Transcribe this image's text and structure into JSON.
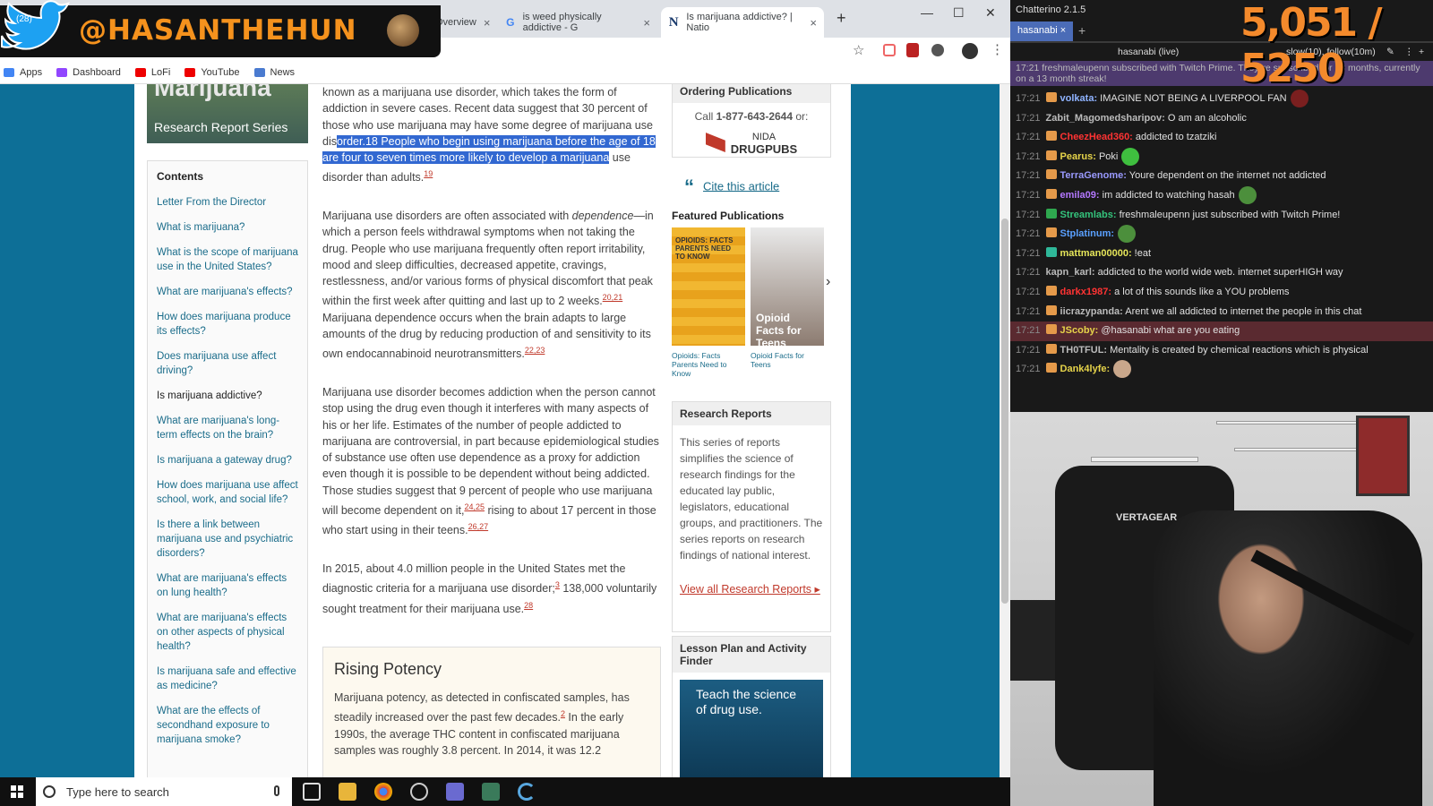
{
  "browser": {
    "tabs": [
      {
        "label": "Overview",
        "close": "×"
      },
      {
        "label": "is weed physically addictive - G",
        "close": "×"
      },
      {
        "label": "Is marijuana addictive? | Natio",
        "close": "×"
      }
    ],
    "new_tab": "+",
    "window_controls": {
      "minimize": "—",
      "maximize": "☐",
      "close": "✕"
    },
    "bookmarks": [
      "Apps",
      "Dashboard",
      "LoFi",
      "YouTube",
      "News"
    ]
  },
  "overlay": {
    "handle": "@HASANTHEHUN",
    "count": "(28)"
  },
  "sidebar": {
    "title": "Marijuana",
    "series": "Research Report Series",
    "contents_title": "Contents",
    "items": [
      "Letter From the Director",
      "What is marijuana?",
      "What is the scope of marijuana use in the United States?",
      "What are marijuana's effects?",
      "How does marijuana produce its effects?",
      "Does marijuana use affect driving?",
      "Is marijuana addictive?",
      "What are marijuana's long-term effects on the brain?",
      "Is marijuana a gateway drug?",
      "How does marijuana use affect school, work, and social life?",
      "Is there a link between marijuana use and psychiatric disorders?",
      "What are marijuana's effects on lung health?",
      "What are marijuana's effects on other aspects of physical health?",
      "Is marijuana safe and effective as medicine?",
      "What are the effects of secondhand exposure to marijuana smoke?"
    ],
    "current_index": 6
  },
  "article": {
    "p1_a": "known as a marijuana use disorder, which takes the form of addiction in severe cases. Recent data suggest that 30 percent of those who use marijuana may have some degree of marijuana use dis",
    "p1_hl": "order.18 People who begin using marijuana before the age of 18 are four to seven times more likely to develop a marijuana",
    "p1_b": " use disorder than adults.",
    "p1_fn": "19",
    "p2_a": "Marijuana use disorders are often associated with ",
    "p2_em": "dependence",
    "p2_b": "—in which a person feels withdrawal symptoms when not taking the drug. People who use marijuana frequently often report irritability, mood and sleep difficulties, decreased appetite, cravings, restlessness, and/or various forms of physical discomfort that peak within the first week after quitting and last up to 2 weeks.",
    "p2_fn1": "20,21",
    "p2_c": " Marijuana dependence occurs when the brain adapts to large amounts of the drug by reducing production of and sensitivity to its own endocannabinoid neurotransmitters.",
    "p2_fn2": "22,23",
    "p3_a": "Marijuana use disorder becomes addiction when the person cannot stop using the drug even though it interferes with many aspects of his or her life. Estimates of the number of people addicted to marijuana are controversial, in part because epidemiological studies of substance use often use dependence as a proxy for addiction even though it is possible to be dependent without being addicted. Those studies suggest that 9 percent of people who use marijuana will become dependent on it,",
    "p3_fn1": "24,25",
    "p3_b": " rising to about 17 percent in those who start using in their teens.",
    "p3_fn2": "26,27",
    "p4_a": "In 2015, about 4.0 million people in the United States met the diagnostic criteria for a marijuana use disorder;",
    "p4_fn1": "3",
    "p4_b": " 138,000 voluntarily sought treatment for their marijuana use.",
    "p4_fn2": "28"
  },
  "rising": {
    "title": "Rising Potency",
    "text_a": "Marijuana potency, as detected in confiscated samples, has steadily increased over the past few decades.",
    "text_fn": "2",
    "text_b": " In the early 1990s, the average THC content in confiscated marijuana samples was roughly 3.8 percent. In 2014, it was 12.2"
  },
  "right": {
    "ordering_title": "Ordering Publications",
    "call_prefix": "Call ",
    "phone": "1-877-643-2644",
    "call_suffix": " or:",
    "nida_1": "NIDA",
    "nida_2": "DRUGPUBS",
    "cite": "Cite this article",
    "featured": "Featured Publications",
    "book1_label": "Opioids: Facts Parents Need to Know",
    "book2_label": "Opioid Facts for Teens",
    "book1_cover": "OPIOIDS: FACTS PARENTS NEED TO KNOW",
    "book2_cover": "Opioid Facts for Teens",
    "research_title": "Research Reports",
    "research_text": "This series of reports simplifies the science of research findings for the educated lay public, legislators, educational groups, and practitioners. The series reports on research findings of national interest.",
    "research_link": "View all Research Reports ▸",
    "lesson_title": "Lesson Plan and Activity Finder",
    "lesson_banner": "Teach the science of drug use."
  },
  "taskbar": {
    "search_placeholder": "Type here to search"
  },
  "chat": {
    "app_title": "Chatterino 2.1.5",
    "tab": "hasanabi",
    "channel": "hasanabi (live)",
    "mode": "slow(10), follow(10m)",
    "sub_notice": "17:21 freshmaleupenn subscribed with Twitch Prime. They've subscribed for 13 months, currently on a 13 month streak!",
    "counter": "5,051 / 5250",
    "messages": [
      {
        "time": "17:21",
        "user": "volkata:",
        "text": " IMAGINE NOT BEING A LIVERPOOL FAN",
        "color": "#8fb3ff",
        "badge": "#e59a4a",
        "emote": "#7a1f1f"
      },
      {
        "time": "17:21",
        "user": "Zabit_Magomedsharipov:",
        "text": " O am an alcoholic",
        "color": "#bbbbbb",
        "badge": "",
        "emote": ""
      },
      {
        "time": "17:21",
        "user": "CheezHead360:",
        "text": " addicted to tzatziki",
        "color": "#ff3333",
        "badge": "#e59a4a",
        "emote": ""
      },
      {
        "time": "17:21",
        "user": "Pearus:",
        "text": " Poki",
        "color": "#e6d44a",
        "badge": "#e59a4a",
        "emote": "#3fbf3f"
      },
      {
        "time": "17:21",
        "user": "TerraGenome:",
        "text": " Youre dependent on the internet not addicted",
        "color": "#9a9aff",
        "badge": "#e59a4a",
        "emote": ""
      },
      {
        "time": "17:21",
        "user": "emila09:",
        "text": " im addicted to watching hasah",
        "color": "#b478ff",
        "badge": "#e59a4a",
        "emote": "#4c8f3c"
      },
      {
        "time": "17:21",
        "user": "Streamlabs:",
        "text": " freshmaleupenn just subscribed with Twitch Prime!",
        "color": "#34c47c",
        "badge": "#2fa84f",
        "emote": ""
      },
      {
        "time": "17:21",
        "user": "Stplatinum:",
        "text": "",
        "color": "#5aa0ff",
        "badge": "#e59a4a",
        "emote": "#4c8f3c"
      },
      {
        "time": "17:21",
        "user": "mattman00000:",
        "text": " !eat",
        "color": "#e6e65a",
        "badge": "#2fb89a",
        "emote": ""
      },
      {
        "time": "17:21",
        "user": "kapn_karl:",
        "text": " addicted to the world wide web. internet superHIGH way",
        "color": "#bbbbbb",
        "badge": "",
        "emote": ""
      },
      {
        "time": "17:21",
        "user": "darkx1987:",
        "text": " a lot of this sounds like a YOU problems",
        "color": "#ff3333",
        "badge": "#e59a4a",
        "emote": ""
      },
      {
        "time": "17:21",
        "user": "iicrazypanda:",
        "text": " Arent we all addicted to internet the people in this chat",
        "color": "#bbbbbb",
        "badge": "#e59a4a",
        "emote": ""
      },
      {
        "time": "17:21",
        "user": "JScoby:",
        "text": " @hasanabi what are you eating",
        "color": "#e6d44a",
        "badge": "#e59a4a",
        "emote": "",
        "highlight": true
      },
      {
        "time": "17:21",
        "user": "TH0TFUL:",
        "text": " Mentality is created by chemical reactions which is physical",
        "color": "#bbbbbb",
        "badge": "#e59a4a",
        "emote": ""
      },
      {
        "time": "17:21",
        "user": "Dank4lyfe:",
        "text": "",
        "color": "#e6d44a",
        "badge": "#e59a4a",
        "emote": "#c9a78b"
      }
    ]
  },
  "webcam": {
    "brand": "VERTAGEAR"
  },
  "colors": {
    "accent": "#f48a2c",
    "link": "#1a6c8a",
    "highlight": "#3268d1",
    "footnote": "#c0392b"
  }
}
